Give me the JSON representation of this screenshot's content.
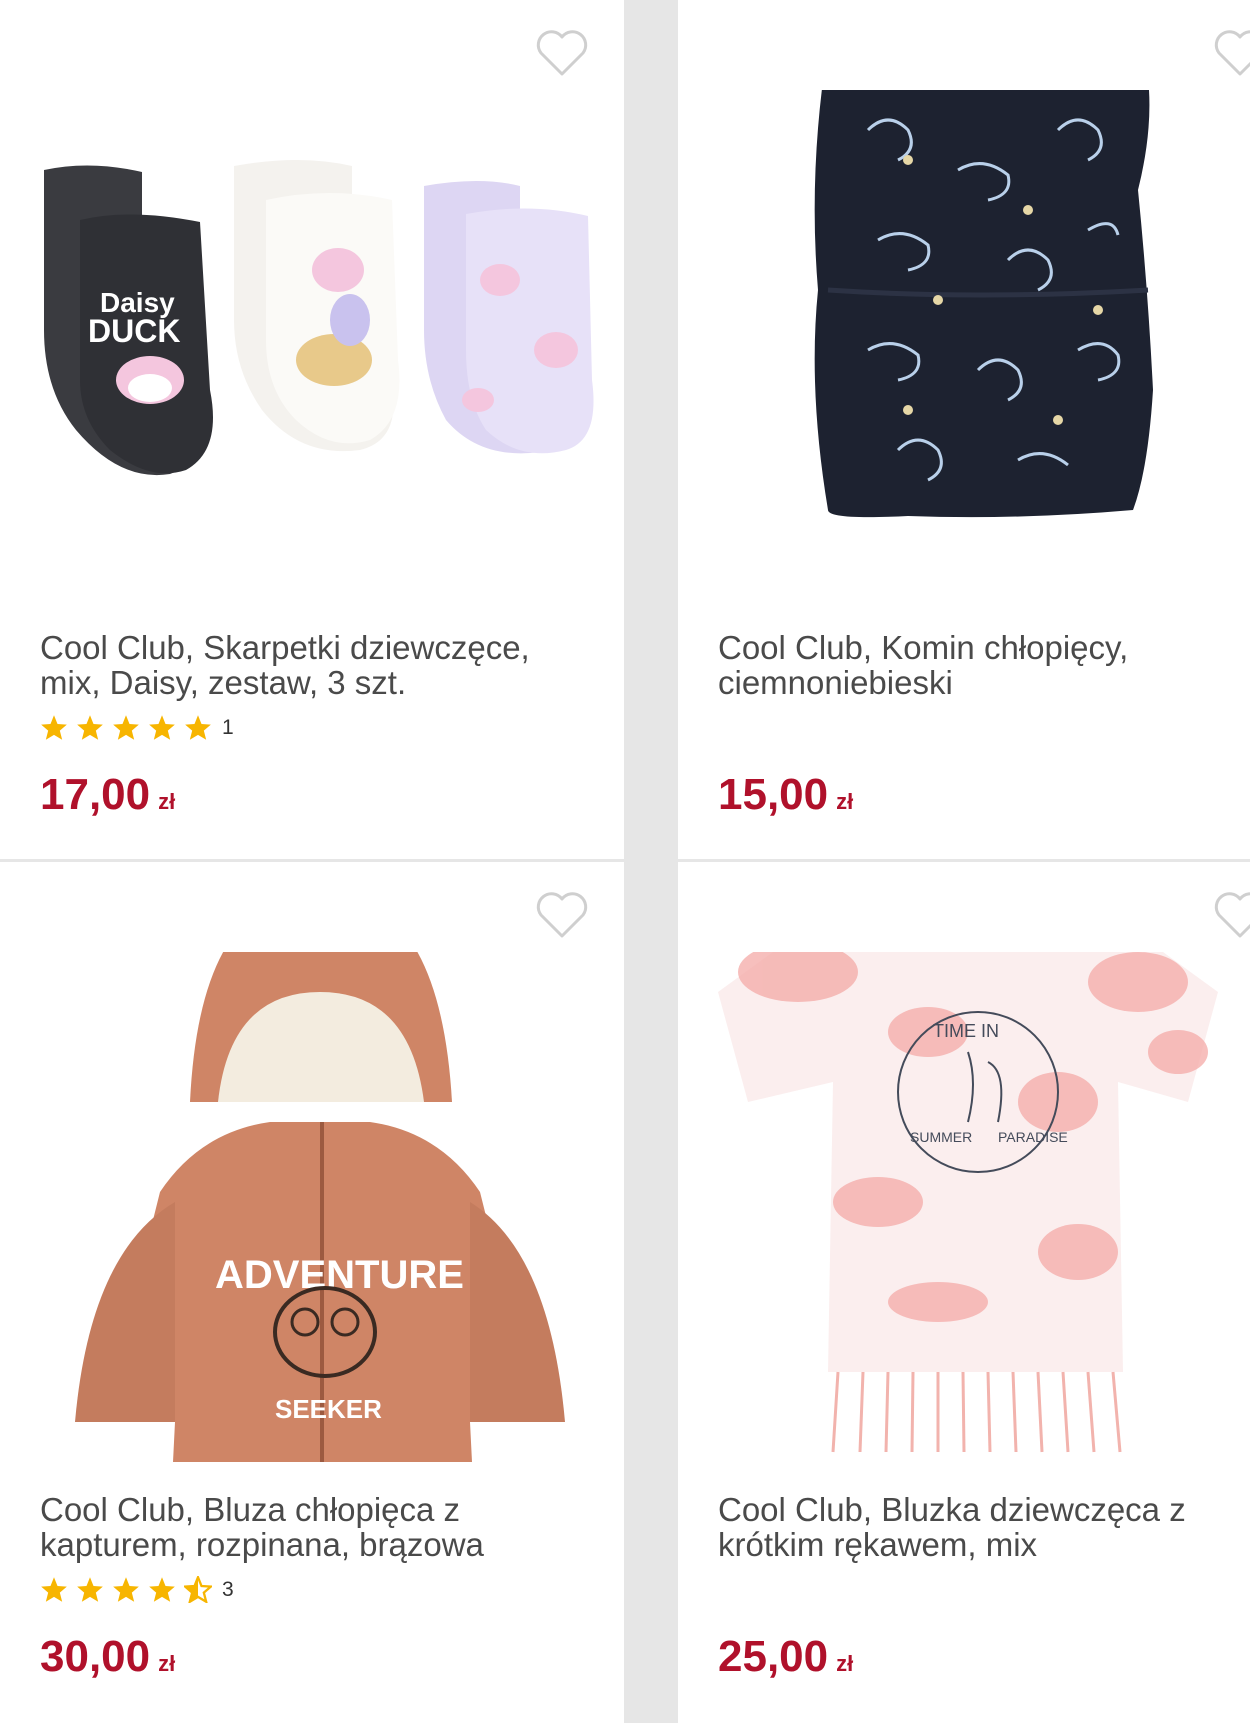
{
  "products": [
    {
      "title": "Cool Club, Skarpetki dziewczęce, mix, Daisy, zestaw, 3 szt.",
      "rating": 5,
      "rating_count": "1",
      "price": "17,00",
      "currency": "zł",
      "image_text_1": "Daisy",
      "image_text_2": "DUCK"
    },
    {
      "title": "Cool Club, Komin chłopięcy, ciemnoniebieski",
      "price": "15,00",
      "currency": "zł"
    },
    {
      "title": "Cool Club, Bluza chłopięca z kapturem, rozpinana, brązowa",
      "rating": 4.5,
      "rating_count": "3",
      "price": "30,00",
      "currency": "zł",
      "image_text_1": "ADVENTURE",
      "image_text_2": "SEEKER"
    },
    {
      "title": "Cool Club, Bluzka dziewczęca z krótkim rękawem, mix",
      "price": "25,00",
      "currency": "zł",
      "image_text_1": "TIME IN",
      "image_text_2": "SUMMER",
      "image_text_3": "PARADISE"
    }
  ],
  "colors": {
    "price": "#b0112b",
    "star": "#f7b500",
    "title": "#4a4a4a",
    "heart": "#cfcfcf"
  },
  "icons": {
    "favorite": "heart-outline-icon",
    "rating": "star-icon"
  }
}
